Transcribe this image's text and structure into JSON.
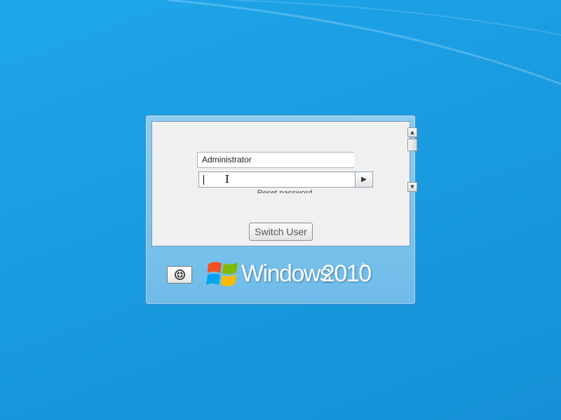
{
  "login": {
    "username": "Administrator",
    "password_value": "",
    "submit_glyph": "▶",
    "hint": "Reset password",
    "switch_user_label": "Switch User"
  },
  "scrollbar": {
    "up_glyph": "▲",
    "down_glyph": "▼"
  },
  "brand": {
    "word": "Windows",
    "version": "2010",
    "mark": "®"
  },
  "icons": {
    "submit": "play-arrow-icon",
    "ease_of_access": "ease-of-access-icon",
    "logo": "windows-flag-icon",
    "cursor": "text-cursor-icon"
  },
  "colors": {
    "desktop": "#1a9be0",
    "frame": "#7cc3ee",
    "panel": "#f0f0f0"
  }
}
